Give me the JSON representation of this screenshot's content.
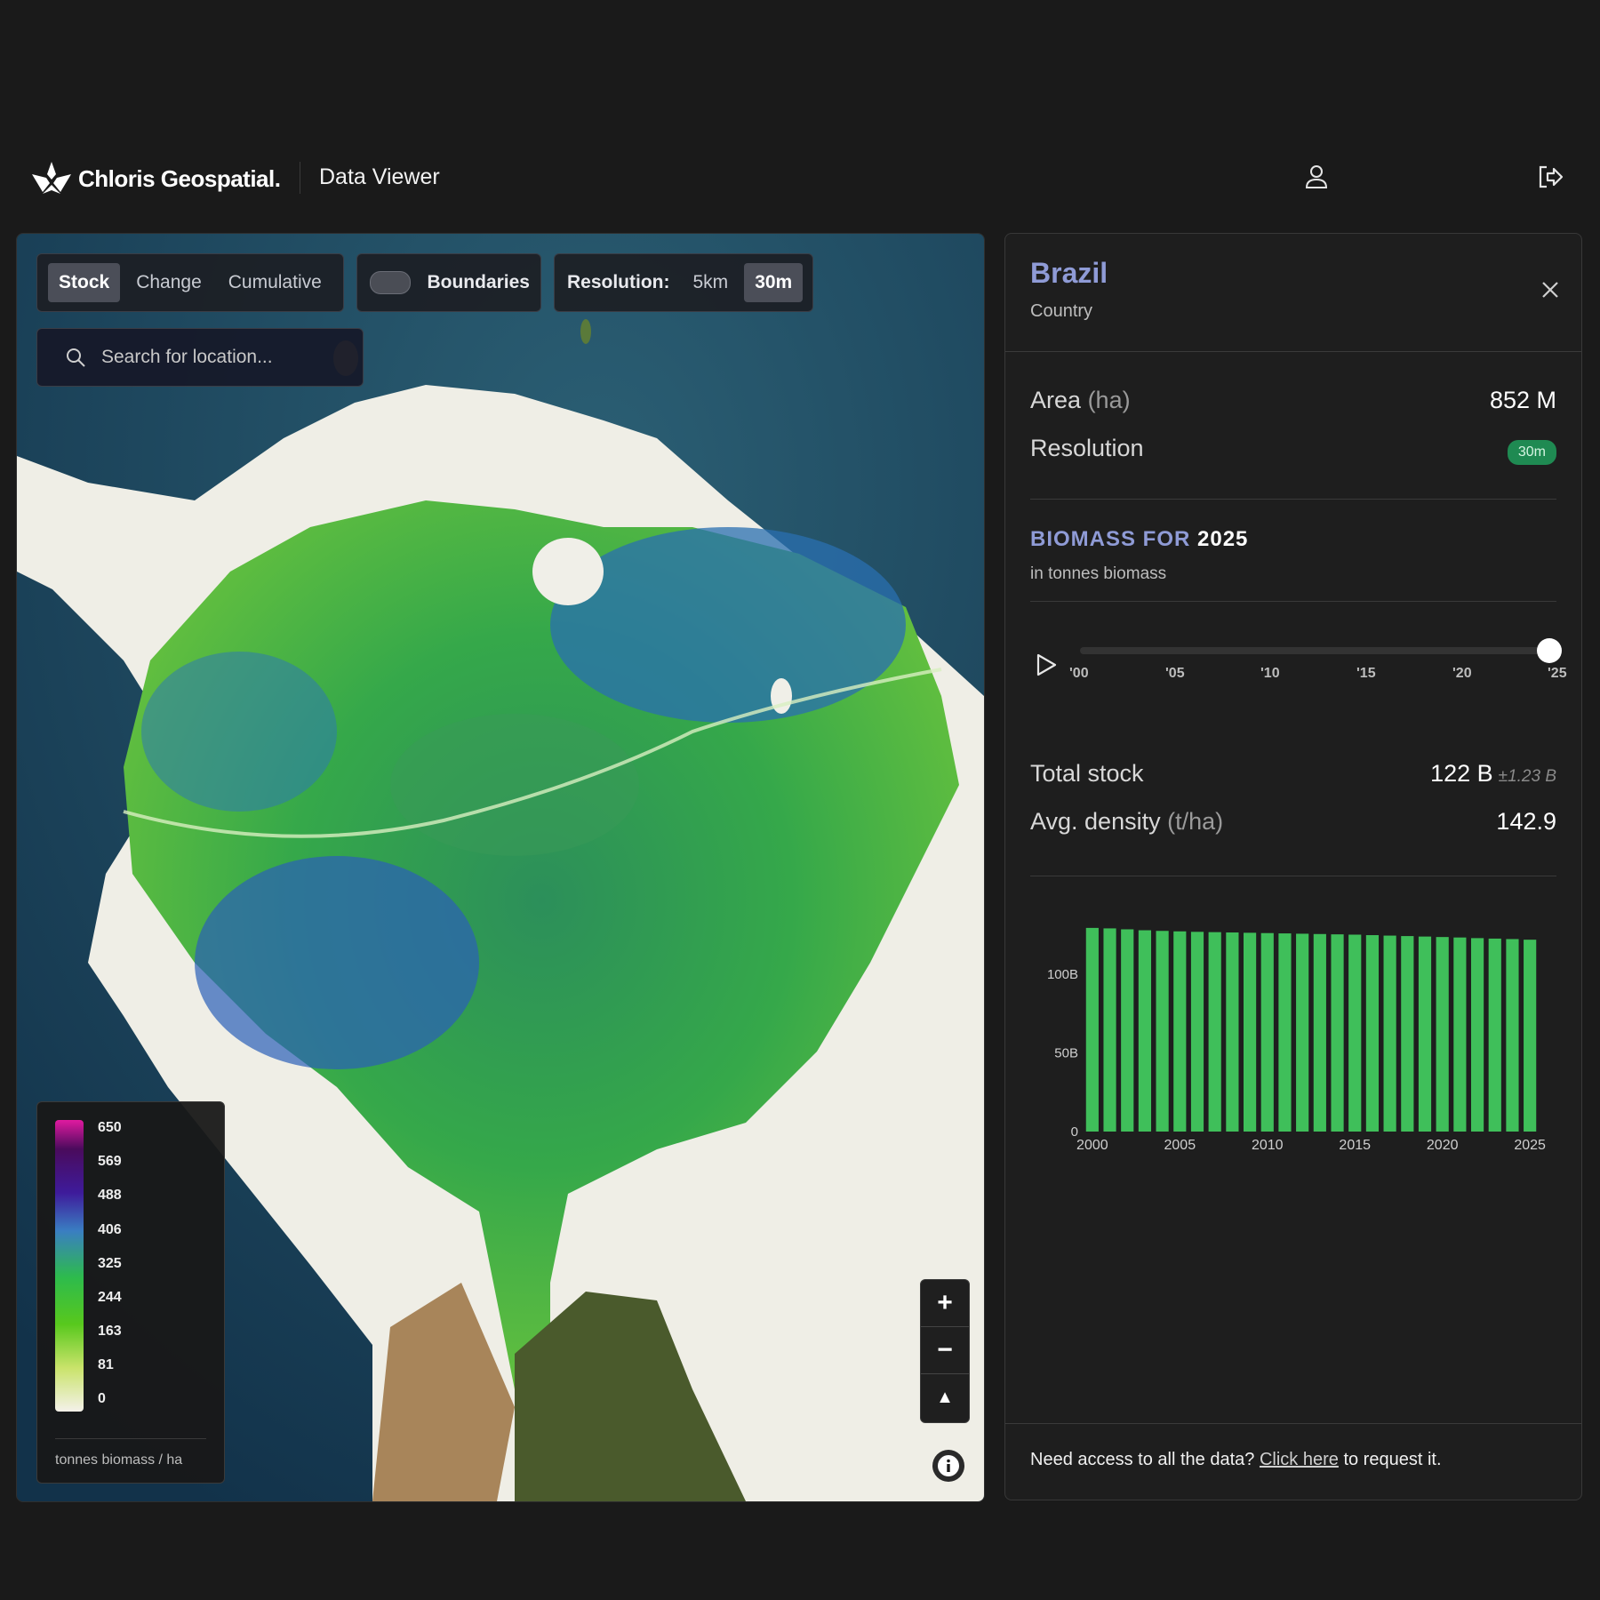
{
  "header": {
    "brand": "Chloris Geospatial.",
    "app_title": "Data Viewer",
    "user_icon": "user-icon",
    "logout_icon": "logout-icon"
  },
  "map": {
    "modes": [
      "Stock",
      "Change",
      "Cumulative"
    ],
    "active_mode": "Stock",
    "boundaries_label": "Boundaries",
    "boundaries_on": false,
    "resolution_label": "Resolution:",
    "resolutions": [
      "5km",
      "30m"
    ],
    "active_resolution": "30m",
    "search_placeholder": "Search for location...",
    "legend": {
      "ticks": [
        "650",
        "569",
        "488",
        "406",
        "325",
        "244",
        "163",
        "81",
        "0"
      ],
      "unit": "tonnes biomass / ha"
    },
    "zoom_in": "+",
    "zoom_out": "−",
    "compass": "▲",
    "info_icon": "info-icon"
  },
  "panel": {
    "title": "Brazil",
    "subtitle": "Country",
    "area_label": "Area",
    "area_unit": "(ha)",
    "area_value": "852 M",
    "resolution_label": "Resolution",
    "resolution_badge": "30m",
    "biomass_head": "BIOMASS FOR",
    "biomass_year": "2025",
    "biomass_sub": "in tonnes biomass",
    "timeline_labels": [
      "'00",
      "'05",
      "'10",
      "'15",
      "'20",
      "'25"
    ],
    "timeline_value": 2025,
    "total_label": "Total stock",
    "total_value": "122 B",
    "total_err": "±1.23 B",
    "density_label": "Avg. density",
    "density_unit": "(t/ha)",
    "density_value": "142.9",
    "footer_text": "Need access to all the data?",
    "footer_link": "Click here",
    "footer_tail": "to request it."
  },
  "chart_data": {
    "type": "bar",
    "x": [
      2000,
      2001,
      2002,
      2003,
      2004,
      2005,
      2006,
      2007,
      2008,
      2009,
      2010,
      2011,
      2012,
      2013,
      2014,
      2015,
      2016,
      2017,
      2018,
      2019,
      2020,
      2021,
      2022,
      2023,
      2024,
      2025
    ],
    "values": [
      129.5,
      129.2,
      128.6,
      128.0,
      127.6,
      127.3,
      127.0,
      126.8,
      126.6,
      126.4,
      126.2,
      126.0,
      125.8,
      125.6,
      125.4,
      125.2,
      124.9,
      124.6,
      124.3,
      124.0,
      123.7,
      123.4,
      123.0,
      122.7,
      122.4,
      122.0
    ],
    "ylim": [
      0,
      130
    ],
    "y_ticks": [
      "0",
      "50B",
      "100B"
    ],
    "x_ticks": [
      "2000",
      "2005",
      "2010",
      "2015",
      "2020",
      "2025"
    ],
    "color": "#3fbf5a"
  }
}
